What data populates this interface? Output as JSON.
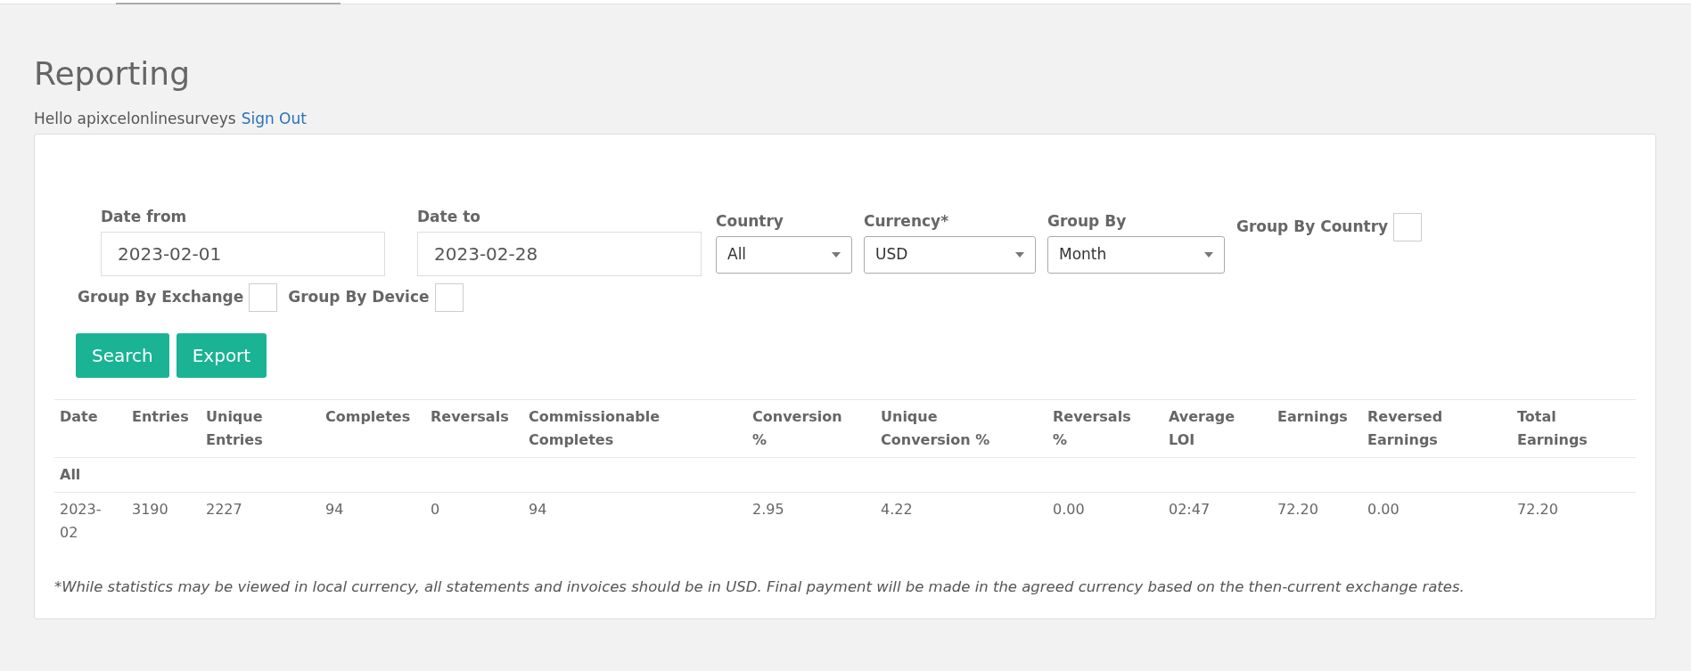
{
  "title": "Reporting",
  "greeting": {
    "text": "Hello apixcelonlinesurveys",
    "link": "Sign Out"
  },
  "filters": {
    "dates": [
      {
        "label": "Date from",
        "value": "2023-02-01"
      },
      {
        "label": "Date to",
        "value": "2023-02-28"
      }
    ],
    "selects": [
      {
        "label": "Country",
        "value": "All"
      },
      {
        "label": "Currency*",
        "value": "USD"
      },
      {
        "label": "Group By",
        "value": "Month"
      }
    ],
    "checkboxes": [
      {
        "label": "Group By Country",
        "checked": false
      },
      {
        "label": "Group By Exchange",
        "checked": false
      },
      {
        "label": "Group By Device",
        "checked": false
      }
    ]
  },
  "buttons": [
    "Search",
    "Export"
  ],
  "table": {
    "columns": [
      "Date",
      "Entries",
      "Unique Entries",
      "Completes",
      "Reversals",
      "Commissionable Completes",
      "Conversion %",
      "Unique Conversion %",
      "Reversals %",
      "Average LOI",
      "Earnings",
      "Reversed Earnings",
      "Total Earnings"
    ],
    "group": "All",
    "rows": [
      [
        "2023-02",
        "3190",
        "2227",
        "94",
        "0",
        "94",
        "2.95",
        "4.22",
        "0.00",
        "02:47",
        "72.20",
        "0.00",
        "72.20"
      ]
    ]
  },
  "footnote": "*While statistics may be viewed in local currency, all statements and invoices should be in USD. Final payment will be made in the agreed currency based on the then-current exchange rates."
}
